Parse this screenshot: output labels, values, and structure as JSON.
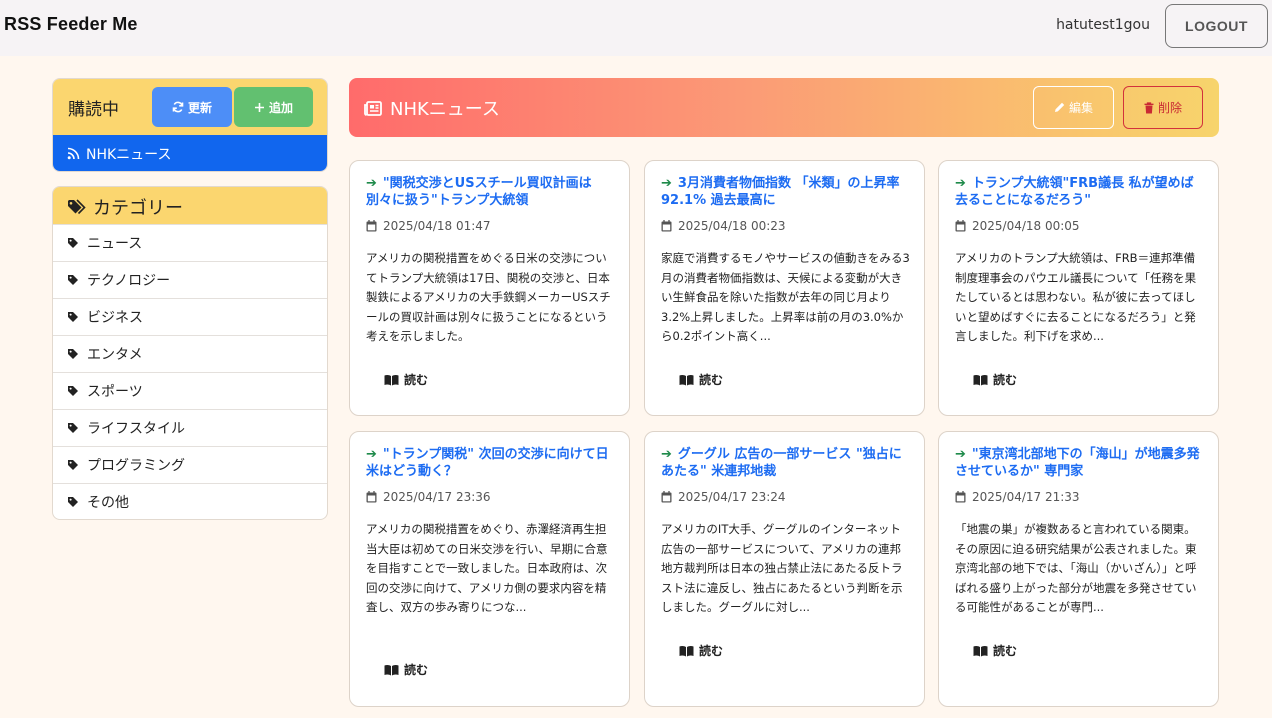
{
  "header": {
    "brand": "RSS Feeder Me",
    "username": "hatutest1gou",
    "logout_label": "LOGOUT"
  },
  "subscriptions": {
    "title": "購読中",
    "refresh_label": "更新",
    "add_label": "追加",
    "feeds": [
      "NHKニュース"
    ]
  },
  "categories": {
    "title": "カテゴリー",
    "items": [
      "ニュース",
      "テクノロジー",
      "ビジネス",
      "エンタメ",
      "スポーツ",
      "ライフスタイル",
      "プログラミング",
      "その他"
    ]
  },
  "feed": {
    "title": "NHKニュース",
    "edit_label": "編集",
    "delete_label": "削除"
  },
  "read_label": "読む",
  "articles": [
    {
      "title": "\"関税交渉とUSスチール買収計画は別々に扱う\"トランプ大統領",
      "date": "2025/04/18 01:47",
      "desc": "アメリカの関税措置をめぐる日米の交渉についてトランプ大統領は17日、関税の交渉と、日本製鉄によるアメリカの大手鉄鋼メーカーUSスチールの買収計画は別々に扱うことになるという考えを示しました。"
    },
    {
      "title": "3月消費者物価指数 「米類」の上昇率92.1% 過去最高に",
      "date": "2025/04/18 00:23",
      "desc": "家庭で消費するモノやサービスの値動きをみる3月の消費者物価指数は、天候による変動が大きい生鮮食品を除いた指数が去年の同じ月より3.2%上昇しました。上昇率は前の月の3.0%から0.2ポイント高く..."
    },
    {
      "title": "トランプ大統領\"FRB議長 私が望めば去ることになるだろう\"",
      "date": "2025/04/18 00:05",
      "desc": "アメリカのトランプ大統領は、FRB＝連邦準備制度理事会のパウエル議長について「任務を果たしているとは思わない。私が彼に去ってほしいと望めばすぐに去ることになるだろう」と発言しました。利下げを求め..."
    },
    {
      "title": "\"トランプ関税\" 次回の交渉に向けて日米はどう動く？",
      "date": "2025/04/17 23:36",
      "desc": "アメリカの関税措置をめぐり、赤澤経済再生担当大臣は初めての日米交渉を行い、早期に合意を目指すことで一致しました。日本政府は、次回の交渉に向けて、アメリカ側の要求内容を精査し、双方の歩み寄りにつな..."
    },
    {
      "title": "グーグル 広告の一部サービス \"独占にあたる\" 米連邦地裁",
      "date": "2025/04/17 23:24",
      "desc": "アメリカのIT大手、グーグルのインターネット広告の一部サービスについて、アメリカの連邦地方裁判所は日本の独占禁止法にあたる反トラスト法に違反し、独占にあたるという判断を示しました。グーグルに対し..."
    },
    {
      "title": "\"東京湾北部地下の「海山」が地震多発させているか\" 専門家",
      "date": "2025/04/17 21:33",
      "desc": "「地震の巣」が複数あると言われている関東。その原因に迫る研究結果が公表されました。東京湾北部の地下では、「海山（かいざん）」と呼ばれる盛り上がった部分が地震を多発させている可能性があることが専門..."
    }
  ]
}
